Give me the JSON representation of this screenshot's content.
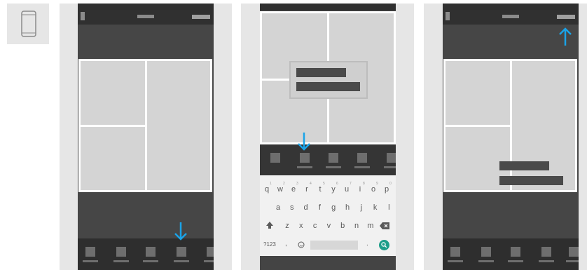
{
  "device_icon": "smartphone-icon",
  "arrow_color": "#1aa3e8",
  "keyboard": {
    "row1": [
      "q",
      "w",
      "e",
      "r",
      "t",
      "y",
      "u",
      "i",
      "o",
      "p"
    ],
    "row1_digits": [
      "1",
      "2",
      "3",
      "4",
      "5",
      "6",
      "7",
      "8",
      "9",
      "0"
    ],
    "row2": [
      "a",
      "s",
      "d",
      "f",
      "g",
      "h",
      "j",
      "k",
      "l"
    ],
    "row3": [
      "z",
      "x",
      "c",
      "v",
      "b",
      "n",
      "m"
    ],
    "symbols_key": "?123",
    "comma_key": ",",
    "period_key": ".",
    "shift_icon": "shift-icon",
    "backspace_icon": "backspace-icon",
    "emoji_icon": "emoji-icon",
    "search_icon": "search-icon"
  }
}
